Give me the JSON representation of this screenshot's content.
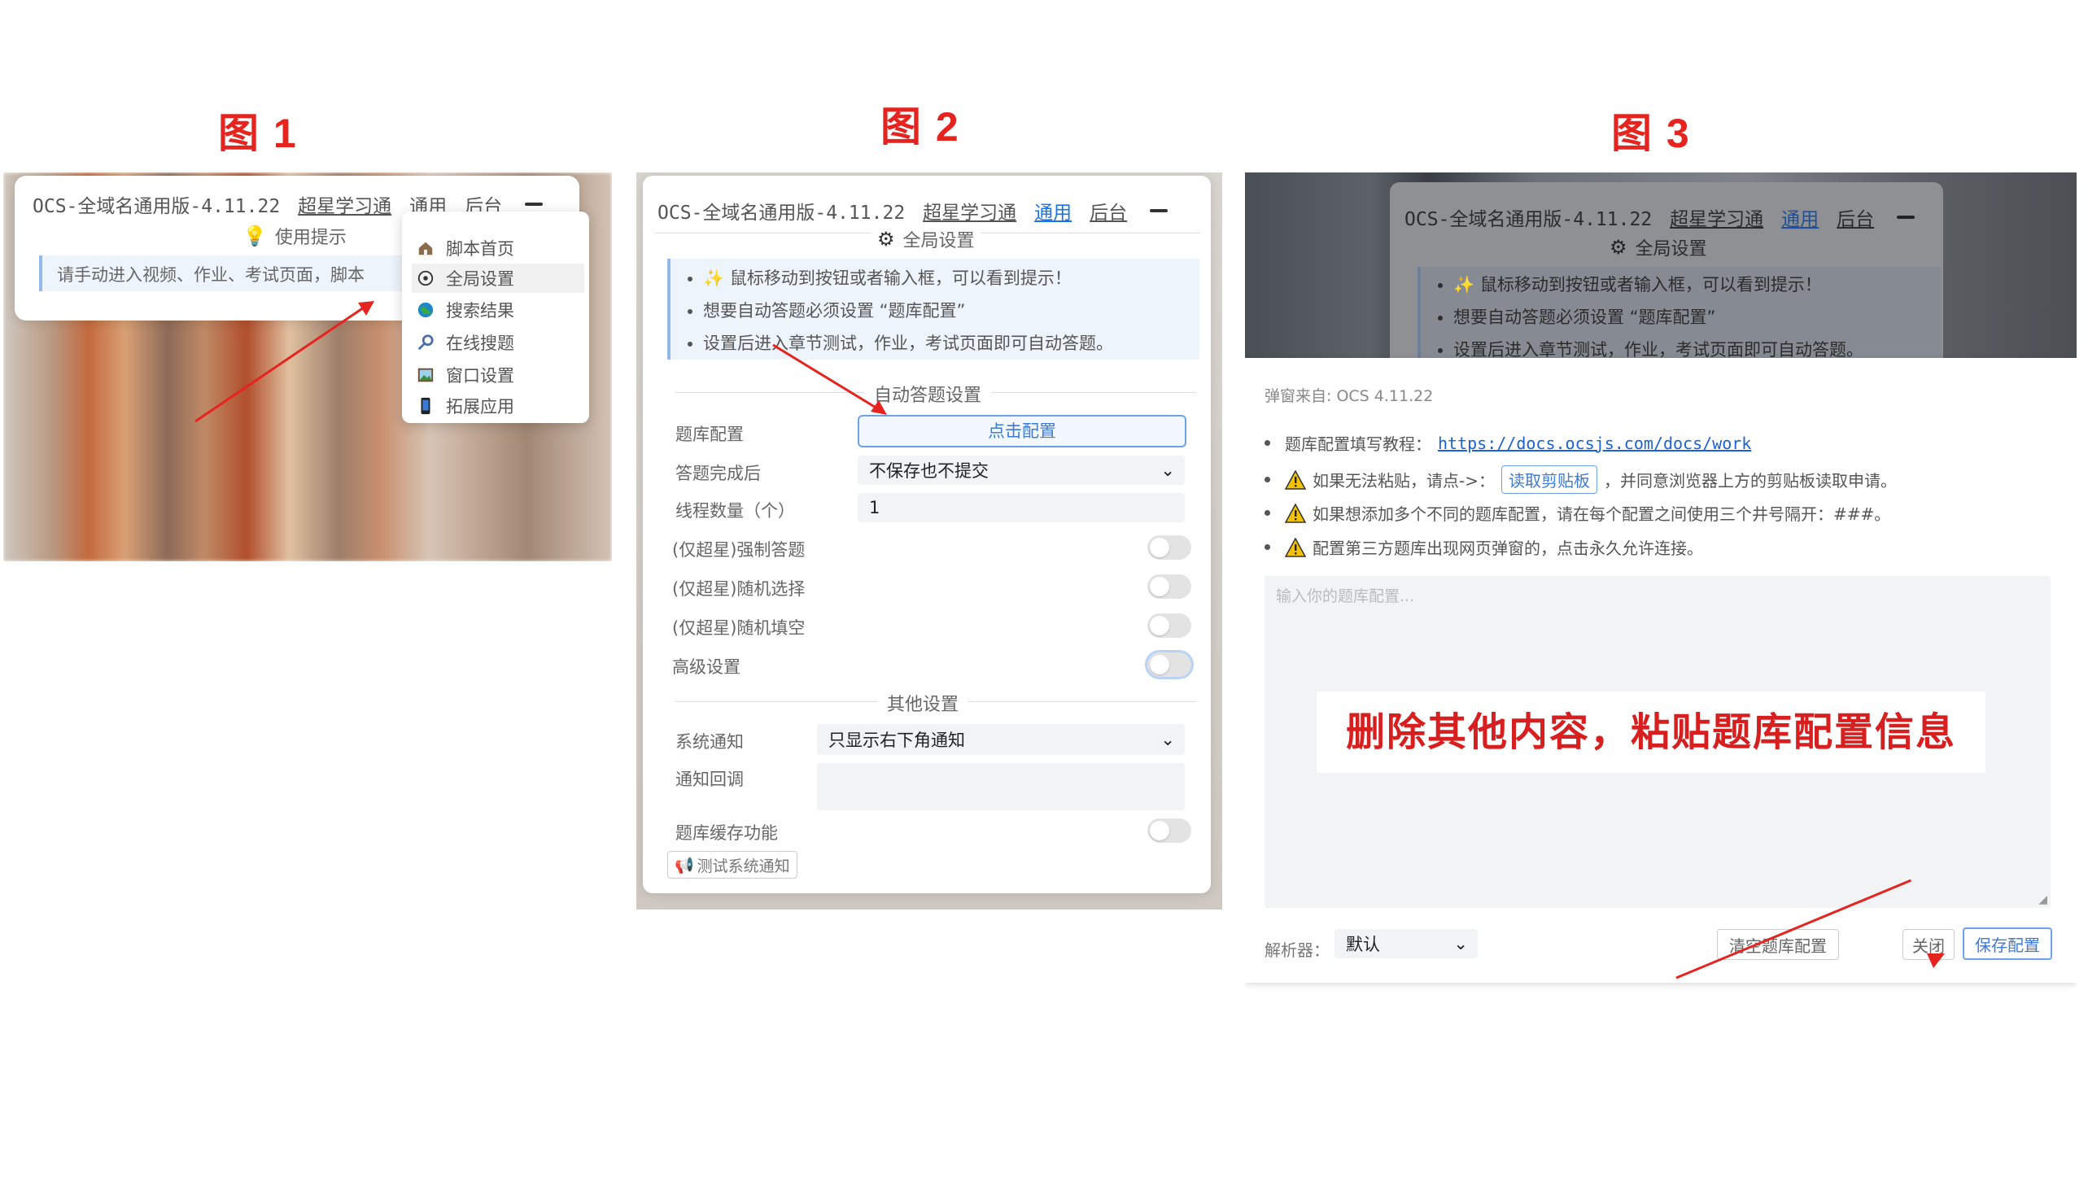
{
  "figures": {
    "fig1": "图 1",
    "fig2": "图 2",
    "fig3": "图 3"
  },
  "header": {
    "title": "OCS-全域名通用版-4.11.22",
    "links": [
      "超星学习通",
      "通用",
      "后台"
    ]
  },
  "fig1": {
    "tip_title": "使用提示",
    "tip_text": "请手动进入视频、作业、考试页面，脚本",
    "menu": [
      "脚本首页",
      "全局设置",
      "搜索结果",
      "在线搜题",
      "窗口设置",
      "拓展应用"
    ]
  },
  "fig2": {
    "section_title": "全局设置",
    "tips": [
      "鼠标移动到按钮或者输入框，可以看到提示！",
      "想要自动答题必须设置 “题库配置”",
      "设置后进入章节测试，作业，考试页面即可自动答题。"
    ],
    "auto_title": "自动答题设置",
    "rows": {
      "bank_label": "题库配置",
      "bank_button": "点击配置",
      "after_label": "答题完成后",
      "after_value": "不保存也不提交",
      "threads_label": "线程数量（个）",
      "threads_value": "1",
      "force_label": "(仅超星)强制答题",
      "random_choice_label": "(仅超星)随机选择",
      "random_fill_label": "(仅超星)随机填空",
      "advanced_label": "高级设置"
    },
    "other_title": "其他设置",
    "other": {
      "notify_label": "系统通知",
      "notify_value": "只显示右下角通知",
      "callback_label": "通知回调",
      "cache_label": "题库缓存功能",
      "test_button": "测试系统通知"
    }
  },
  "fig3": {
    "source": "弹窗来自: OCS 4.11.22",
    "line1_prefix": "题库配置填写教程：",
    "line1_link": "https://docs.ocsjs.com/docs/work",
    "line2_a": "如果无法粘贴，请点->：",
    "line2_btn": "读取剪贴板",
    "line2_b": "，并同意浏览器上方的剪贴板读取申请。",
    "line3": "如果想添加多个不同的题库配置，请在每个配置之间使用三个井号隔开：###。",
    "line4": "配置第三方题库出现网页弹窗的，点击永久允许连接。",
    "placeholder": "输入你的题库配置...",
    "note": "删除其他内容，粘贴题库配置信息",
    "parser_label": "解析器：",
    "parser_value": "默认",
    "clear_button": "清空题库配置",
    "close_button": "关闭",
    "save_button": "保存配置"
  },
  "colors": {
    "accent": "#1a73e8",
    "arrow": "#e5231f",
    "figure_label": "#e5231f",
    "note": "#d71f1f"
  }
}
